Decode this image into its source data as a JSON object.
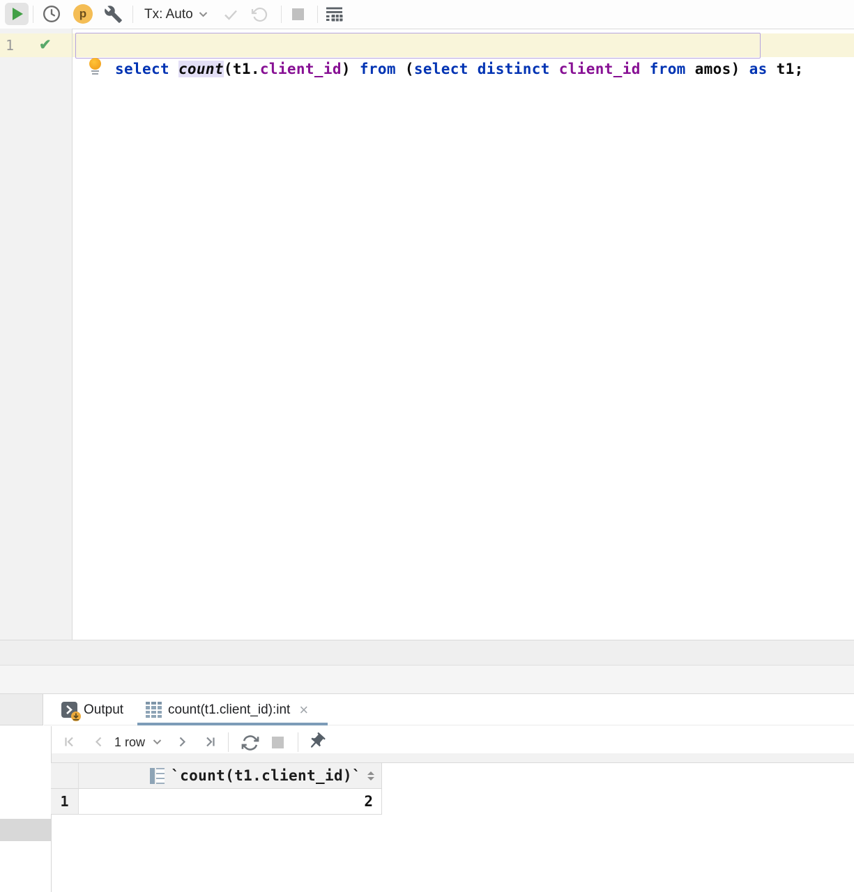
{
  "toolbar": {
    "tx_label": "Tx: Auto",
    "profile_badge": "p"
  },
  "editor": {
    "line_number": "1",
    "executed_check": "✔",
    "statement_tokens": [
      {
        "t": "select ",
        "c": "kw"
      },
      {
        "t": "count",
        "c": "fn"
      },
      {
        "t": "(t1.",
        "c": "pl"
      },
      {
        "t": "client_id",
        "c": "col"
      },
      {
        "t": ") ",
        "c": "pl"
      },
      {
        "t": "from",
        "c": "kw"
      },
      {
        "t": " (",
        "c": "pl"
      },
      {
        "t": "select",
        "c": "kw"
      },
      {
        "t": " ",
        "c": "pl"
      },
      {
        "t": "distinct",
        "c": "kw"
      },
      {
        "t": " ",
        "c": "pl"
      },
      {
        "t": "client_id",
        "c": "col"
      },
      {
        "t": " ",
        "c": "pl"
      },
      {
        "t": "from",
        "c": "kw"
      },
      {
        "t": " amos) ",
        "c": "pl"
      },
      {
        "t": "as",
        "c": "kw"
      },
      {
        "t": " t1",
        "c": "pl"
      }
    ],
    "trailing": ";"
  },
  "output_panel": {
    "tabs": [
      {
        "label": "Output"
      },
      {
        "label": "count(t1.client_id):int",
        "close": "×"
      }
    ],
    "pager_label": "1 row",
    "grid": {
      "column_header": "`count(t1.client_id)`",
      "rows": [
        {
          "num": "1",
          "value": "2"
        }
      ]
    }
  },
  "colors": {
    "keyword": "#0033b3",
    "column_ref": "#871094",
    "function_highlight_bg": "#e3dff6",
    "current_line_bg": "#f9f5da",
    "statement_border": "#b5a3df",
    "run_green": "#43a047",
    "check_green": "#59a869",
    "bulb_orange": "#f5a824",
    "badge_amber": "#f4bd55",
    "active_tab_underline": "#7d9cb8"
  }
}
